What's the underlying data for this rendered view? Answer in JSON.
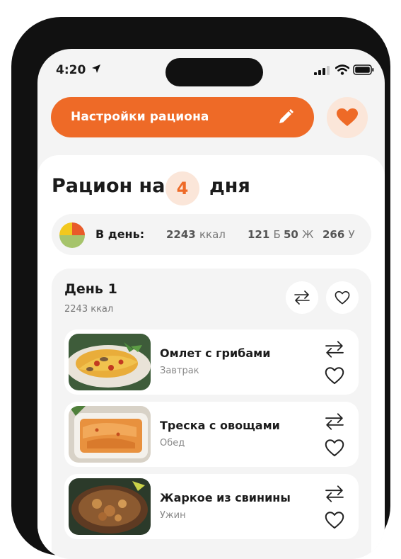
{
  "status_bar": {
    "time": "4:20"
  },
  "header": {
    "settings_label": "Настройки рациона"
  },
  "plan": {
    "title_prefix": "Рацион на",
    "days": "4",
    "title_suffix": "дня"
  },
  "daily_stats": {
    "label": "В день:",
    "kcal_value": "2243",
    "kcal_unit": "ккал",
    "protein_value": "121",
    "protein_unit": "Б",
    "fat_value": "50",
    "fat_unit": "Ж",
    "carbs_value": "266",
    "carbs_unit": "У",
    "pie_colors": [
      "#f2c81e",
      "#e85b2a",
      "#a6c46b"
    ]
  },
  "day": {
    "title": "День 1",
    "kcal": "2243 ккал",
    "meals": [
      {
        "name": "Омлет с грибами",
        "type": "Завтрак"
      },
      {
        "name": "Треска с овощами",
        "type": "Обед"
      },
      {
        "name": "Жаркое из свинины",
        "type": "Ужин"
      }
    ]
  },
  "colors": {
    "accent": "#ee6a27",
    "accent_light": "#fbe6d9",
    "background": "#f4f4f4"
  }
}
